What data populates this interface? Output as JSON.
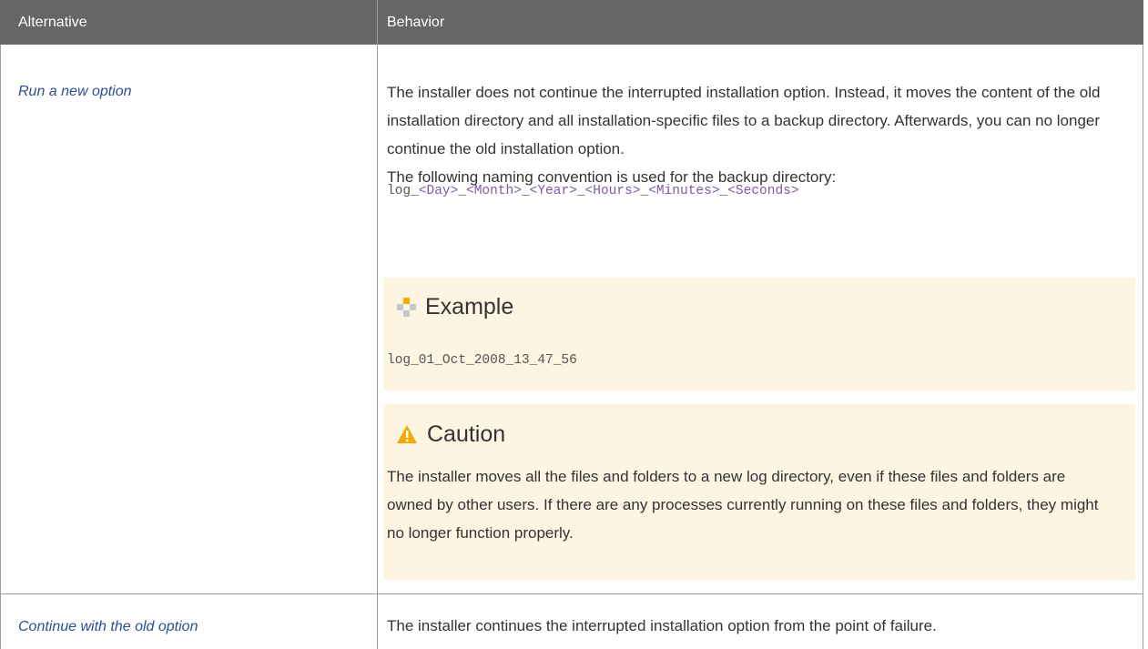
{
  "table": {
    "headers": {
      "alternative": "Alternative",
      "behavior": "Behavior"
    },
    "rows": [
      {
        "alternative": "Run a new option",
        "behavior": {
          "paragraph1": "The installer does not continue the interrupted installation option. Instead, it moves the content of the old installation directory and all installation-specific files to a backup directory. Afterwards, you can no longer continue the old installation option.",
          "paragraph2": "The following naming convention is used for the backup directory:",
          "naming_pattern": {
            "prefix": "log_",
            "day": "<Day>",
            "sep1": "_",
            "month": "<Month>",
            "sep2": "_",
            "year": "<Year>",
            "sep3": "_",
            "hours": "<Hours>",
            "sep4": "_",
            "minutes": "<Minutes>",
            "sep5": "_",
            "seconds": "<Seconds>"
          },
          "example": {
            "title": "Example",
            "icon": "example-icon",
            "code": "log_01_Oct_2008_13_47_56"
          },
          "caution": {
            "title": "Caution",
            "icon": "warning-icon",
            "text": "The installer moves all the files and folders to a new log directory, even if these files and folders are owned by other users. If there are any processes currently running on these files and folders, they might no longer function properly."
          }
        }
      },
      {
        "alternative": "Continue with the old option",
        "behavior": {
          "paragraph1": "The installer continues the interrupted installation option from the point of failure."
        }
      }
    ]
  },
  "colors": {
    "header_bg": "#666666",
    "link": "#2a4f8f",
    "placeholder": "#7a5aa8",
    "note_bg": "#fdf5e2",
    "warning": "#f0ab00"
  }
}
